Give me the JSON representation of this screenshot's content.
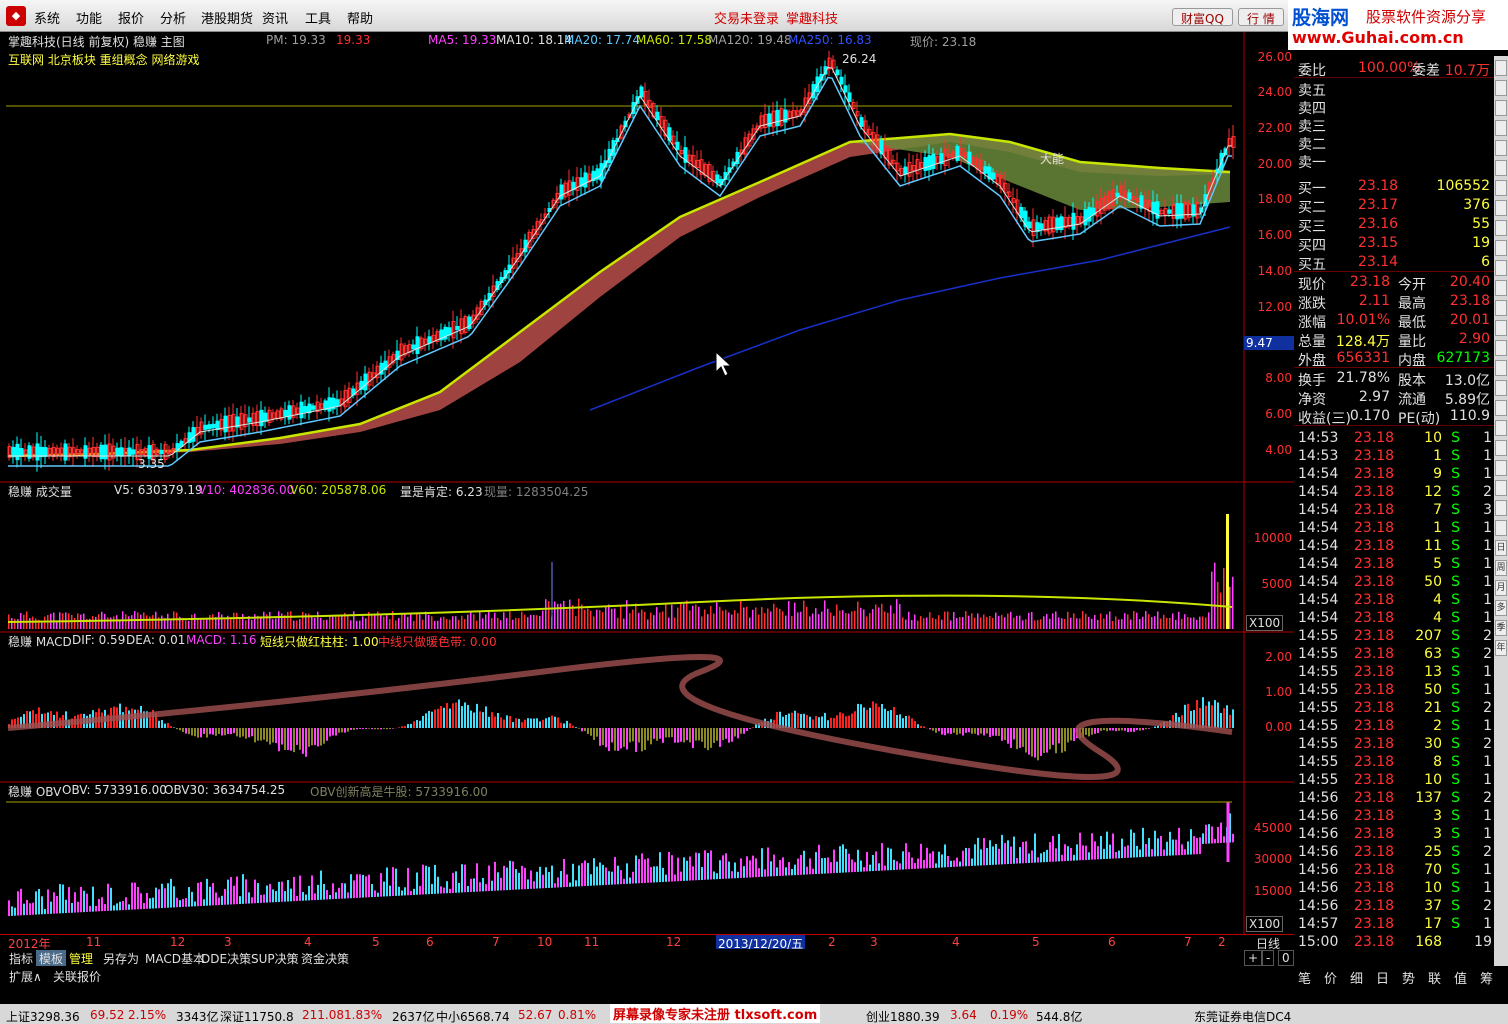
{
  "menubar": {
    "items": [
      "系统",
      "功能",
      "报价",
      "分析",
      "港股期货",
      "资讯",
      "工具",
      "帮助"
    ],
    "notice_login": "交易未登录",
    "notice_brand": "掌趣科技",
    "qq_button": "财富QQ",
    "quote_button": "行 情"
  },
  "brand": {
    "name": "股海网",
    "slogan": "股票软件资源分享",
    "url": "www.Guhai.com.cn"
  },
  "main_panel": {
    "title": "掌趣科技(日线 前复权) 稳赚 主图",
    "pm_label": "PM: 19.33",
    "pm_value": "19.33",
    "ma5": "MA5: 19.33",
    "ma10": "MA10: 18.14",
    "ma20": "MA20: 17.74",
    "ma60": "MA60: 17.58",
    "ma120": "MA120: 19.48",
    "ma250": "MA250: 16.83",
    "current_price": "现价: 23.18",
    "concepts": "互联网 北京板块 重组概念 网络游戏",
    "high_label": "26.24",
    "low_label": "3.35",
    "mark_label": "大能",
    "hover_price": "9.47",
    "y_ticks": [
      "26.00",
      "24.00",
      "22.00",
      "20.00",
      "18.00",
      "16.00",
      "14.00",
      "12.00",
      "10.00",
      "8.00",
      "6.00",
      "4.00"
    ]
  },
  "volume_panel": {
    "title": "稳赚 成交量",
    "v5": "V5: 630379.19",
    "v10": "V10: 402836.00",
    "v60": "V60: 205878.06",
    "positive": "量是肯定: 6.23",
    "now": "现量: 1283504.25",
    "y_ticks": [
      "10000",
      "5000"
    ],
    "unit": "X100"
  },
  "macd_panel": {
    "title": "稳赚 MACD",
    "dif": "DIF: 0.59",
    "dea": "DEA: 0.01",
    "macd": "MACD: 1.16",
    "short_rule": "短线只做红柱柱: 1.00",
    "mid_rule": "中线只做暖色带: 0.00",
    "y_ticks": [
      "2.00",
      "1.00",
      "0.00"
    ]
  },
  "obv_panel": {
    "title": "稳赚 OBV",
    "obv": "OBV: 5733916.00",
    "obv30": "OBV30: 3634754.25",
    "new_high": "OBV创新高是牛股: 5733916.00",
    "y_ticks": [
      "45000",
      "30000",
      "15000"
    ],
    "unit": "X100"
  },
  "xaxis": {
    "labels": [
      "2012年",
      "11",
      "12",
      "3",
      "4",
      "5",
      "6",
      "7",
      "10",
      "11",
      "12",
      "2013/12/20/五",
      "2",
      "3",
      "4",
      "5",
      "6",
      "7",
      "2"
    ],
    "period": "日线"
  },
  "tabs": [
    "指标",
    "模板",
    "管理",
    "另存为",
    "MACD基本",
    "DDE决策",
    "SUP决策",
    "资金决策"
  ],
  "tabs_bottom": [
    "扩展∧",
    "关联报价"
  ],
  "zoom_controls": [
    "+",
    "-",
    "0"
  ],
  "quote": {
    "weibi": [
      "委比",
      "100.00%",
      "委差",
      "10.7万"
    ],
    "asks": [
      "卖五",
      "卖四",
      "卖三",
      "卖二",
      "卖一"
    ],
    "bids": [
      [
        "买一",
        "23.18",
        "106552"
      ],
      [
        "买二",
        "23.17",
        "376"
      ],
      [
        "买三",
        "23.16",
        "55"
      ],
      [
        "买四",
        "23.15",
        "19"
      ],
      [
        "买五",
        "23.14",
        "6"
      ]
    ],
    "stats": [
      [
        "现价",
        "23.18",
        "今开",
        "20.40"
      ],
      [
        "涨跌",
        "2.11",
        "最高",
        "23.18"
      ],
      [
        "涨幅",
        "10.01%",
        "最低",
        "20.01"
      ],
      [
        "总量",
        "128.4万",
        "量比",
        "2.90"
      ],
      [
        "外盘",
        "656331",
        "内盘",
        "627173"
      ]
    ],
    "fund": [
      [
        "换手",
        "21.78%",
        "股本",
        "13.0亿"
      ],
      [
        "净资",
        "2.97",
        "流通",
        "5.89亿"
      ],
      [
        "收益(三)",
        "0.170",
        "PE(动)",
        "110.9"
      ]
    ],
    "ticks": [
      [
        "14:53",
        "23.18",
        "10",
        "S",
        "1"
      ],
      [
        "14:53",
        "23.18",
        "1",
        "S",
        "1"
      ],
      [
        "14:54",
        "23.18",
        "9",
        "S",
        "1"
      ],
      [
        "14:54",
        "23.18",
        "12",
        "S",
        "2"
      ],
      [
        "14:54",
        "23.18",
        "7",
        "S",
        "3"
      ],
      [
        "14:54",
        "23.18",
        "1",
        "S",
        "1"
      ],
      [
        "14:54",
        "23.18",
        "11",
        "S",
        "1"
      ],
      [
        "14:54",
        "23.18",
        "5",
        "S",
        "1"
      ],
      [
        "14:54",
        "23.18",
        "50",
        "S",
        "1"
      ],
      [
        "14:54",
        "23.18",
        "4",
        "S",
        "1"
      ],
      [
        "14:54",
        "23.18",
        "4",
        "S",
        "1"
      ],
      [
        "14:55",
        "23.18",
        "207",
        "S",
        "2"
      ],
      [
        "14:55",
        "23.18",
        "63",
        "S",
        "2"
      ],
      [
        "14:55",
        "23.18",
        "13",
        "S",
        "1"
      ],
      [
        "14:55",
        "23.18",
        "50",
        "S",
        "1"
      ],
      [
        "14:55",
        "23.18",
        "21",
        "S",
        "2"
      ],
      [
        "14:55",
        "23.18",
        "2",
        "S",
        "1"
      ],
      [
        "14:55",
        "23.18",
        "30",
        "S",
        "2"
      ],
      [
        "14:55",
        "23.18",
        "8",
        "S",
        "1"
      ],
      [
        "14:55",
        "23.18",
        "10",
        "S",
        "1"
      ],
      [
        "14:56",
        "23.18",
        "137",
        "S",
        "2"
      ],
      [
        "14:56",
        "23.18",
        "3",
        "S",
        "1"
      ],
      [
        "14:56",
        "23.18",
        "3",
        "S",
        "1"
      ],
      [
        "14:56",
        "23.18",
        "25",
        "S",
        "2"
      ],
      [
        "14:56",
        "23.18",
        "70",
        "S",
        "1"
      ],
      [
        "14:56",
        "23.18",
        "10",
        "S",
        "1"
      ],
      [
        "14:56",
        "23.18",
        "37",
        "S",
        "2"
      ],
      [
        "14:57",
        "23.18",
        "17",
        "S",
        "1"
      ],
      [
        "15:00",
        "23.18",
        "168",
        "",
        "19"
      ]
    ],
    "bottom_tabs": [
      "笔",
      "价",
      "细",
      "日",
      "势",
      "联",
      "值",
      "筹"
    ]
  },
  "side_labels": [
    "日",
    "周",
    "月",
    "多",
    "季",
    "年"
  ],
  "status": {
    "sh": "上证3298.36",
    "sh_chg": "69.52",
    "sh_pct": "2.15%",
    "sh_amt": "3343亿",
    "sz": "深证11750.8",
    "sz_chg": "211.08",
    "sz_pct": "1.83%",
    "sz_amt": "2637亿",
    "zx": "中小6568.74",
    "zx_chg": "52.67",
    "zx_pct": "0.81%",
    "cy": "创业1880.39",
    "cy_chg": "3.64",
    "cy_pct": "0.19%",
    "cy_amt": "544.8亿",
    "broker": "东莞证券电信DC4",
    "watermark": "屏幕录像专家未注册 tlxsoft.com"
  },
  "colors": {
    "up": "#ff3030",
    "down": "#00ffff",
    "ma5": "#ff40ff",
    "ma20": "#60c8ff",
    "ma60": "#c8e600",
    "ma250": "#1830c8",
    "band": "#b04a48",
    "band_green": "#6a8a3a"
  }
}
